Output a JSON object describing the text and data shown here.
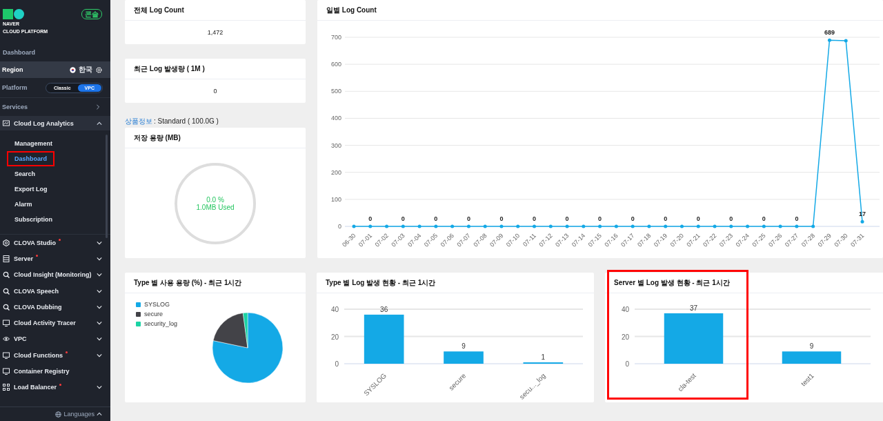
{
  "sidebar": {
    "logo_text": [
      "NAVER",
      "CLOUD PLATFORM"
    ],
    "badge": "콘솔",
    "dashboard": "Dashboard",
    "region": {
      "label": "Region",
      "value": "한국"
    },
    "platform": {
      "label": "Platform",
      "options": [
        {
          "label": "Classic",
          "selected": false
        },
        {
          "label": "VPC",
          "selected": true
        }
      ]
    },
    "services_label": "Services",
    "open_service": {
      "label": "Cloud Log Analytics",
      "expanded": true,
      "children": [
        {
          "label": "Management",
          "selected": false,
          "highlighted": false
        },
        {
          "label": "Dashboard",
          "selected": true,
          "highlighted": true
        },
        {
          "label": "Search",
          "selected": false,
          "highlighted": false
        },
        {
          "label": "Export Log",
          "selected": false,
          "highlighted": false
        },
        {
          "label": "Alarm",
          "selected": false,
          "highlighted": false
        },
        {
          "label": "Subscription",
          "selected": false,
          "highlighted": false
        }
      ]
    },
    "services": [
      {
        "label": "CLOVA Studio",
        "dot": true,
        "expandable": true
      },
      {
        "label": "Server",
        "dot": true,
        "expandable": true
      },
      {
        "label": "Cloud Insight (Monitoring)",
        "dot": false,
        "expandable": true
      },
      {
        "label": "CLOVA Speech",
        "dot": false,
        "expandable": true
      },
      {
        "label": "CLOVA Dubbing",
        "dot": false,
        "expandable": true
      },
      {
        "label": "Cloud Activity Tracer",
        "dot": false,
        "expandable": true
      },
      {
        "label": "VPC",
        "dot": false,
        "expandable": true
      },
      {
        "label": "Cloud Functions",
        "dot": true,
        "expandable": true
      },
      {
        "label": "Container Registry",
        "dot": false,
        "expandable": false
      },
      {
        "label": "Load Balancer",
        "dot": true,
        "expandable": true
      }
    ],
    "languages": "Languages"
  },
  "summary_cards": [
    {
      "title": "전체 Log Count",
      "value": "1,472"
    },
    {
      "title": "최근 Log 발생량 ( 1M )",
      "value": "0"
    }
  ],
  "product_info": {
    "link": "상품정보",
    "text": ": Standard ( 100.0G )"
  },
  "storage": {
    "title": "저장 용량 (MB)",
    "percent": "0.0 %",
    "used": "1.0MB Used"
  },
  "daily_chart": {
    "title": "일별 Log Count",
    "chart_data": {
      "type": "line",
      "x": [
        "06-30",
        "07-01",
        "07-02",
        "07-03",
        "07-04",
        "07-05",
        "07-06",
        "07-07",
        "07-08",
        "07-09",
        "07-10",
        "07-11",
        "07-12",
        "07-13",
        "07-14",
        "07-15",
        "07-16",
        "07-17",
        "07-18",
        "07-19",
        "07-20",
        "07-21",
        "07-22",
        "07-23",
        "07-24",
        "07-25",
        "07-26",
        "07-27",
        "07-28",
        "07-29",
        "07-30",
        "07-31"
      ],
      "grid": true,
      "series": [
        {
          "color": "#14a9e6",
          "values": [
            0,
            0,
            0,
            0,
            0,
            0,
            0,
            0,
            0,
            0,
            0,
            0,
            0,
            0,
            0,
            0,
            0,
            0,
            0,
            0,
            0,
            0,
            0,
            0,
            0,
            0,
            0,
            0,
            0,
            689,
            687,
            17
          ]
        }
      ],
      "value_labels": [
        null,
        "0",
        null,
        "0",
        null,
        "0",
        null,
        "0",
        null,
        "0",
        null,
        "0",
        null,
        "0",
        null,
        "0",
        null,
        "0",
        null,
        "0",
        null,
        "0",
        null,
        "0",
        null,
        "0",
        null,
        "0",
        null,
        "689",
        null,
        "17"
      ],
      "ylim": [
        0,
        700
      ],
      "yticks": [
        0,
        100,
        200,
        300,
        400,
        500,
        600,
        700
      ]
    }
  },
  "type_usage": {
    "title": "Type 별 사용 용량 (%) - 최근 1시간",
    "chart_data": {
      "type": "pie",
      "categories": [
        "SYSLOG",
        "secure",
        "security_log"
      ],
      "values": [
        78.3,
        19.6,
        2.1
      ],
      "colors": [
        "#14a9e6",
        "#434348",
        "#1bd3a4"
      ],
      "legend": true
    }
  },
  "type_chart": {
    "title": "Type 별 Log 발생 현황 - 최근 1시간",
    "chart_data": {
      "type": "bar",
      "categories": [
        "SYSLOG",
        "secure",
        "secu..._log"
      ],
      "grid": true,
      "series": [
        {
          "color": "#14a9e6",
          "values": [
            36,
            9,
            1
          ]
        }
      ],
      "ylim": [
        0,
        40
      ],
      "yticks": [
        0,
        20,
        40
      ],
      "data_labels": true
    }
  },
  "server_chart": {
    "title": "Server 별 Log 발생 현황 - 최근 1시간",
    "highlighted": true,
    "chart_data": {
      "type": "bar",
      "categories": [
        "cla-test",
        "test1"
      ],
      "grid": true,
      "series": [
        {
          "color": "#14a9e6",
          "values": [
            37,
            9
          ]
        }
      ],
      "ylim": [
        0,
        40
      ],
      "yticks": [
        0,
        20,
        40
      ],
      "data_labels": true
    }
  }
}
